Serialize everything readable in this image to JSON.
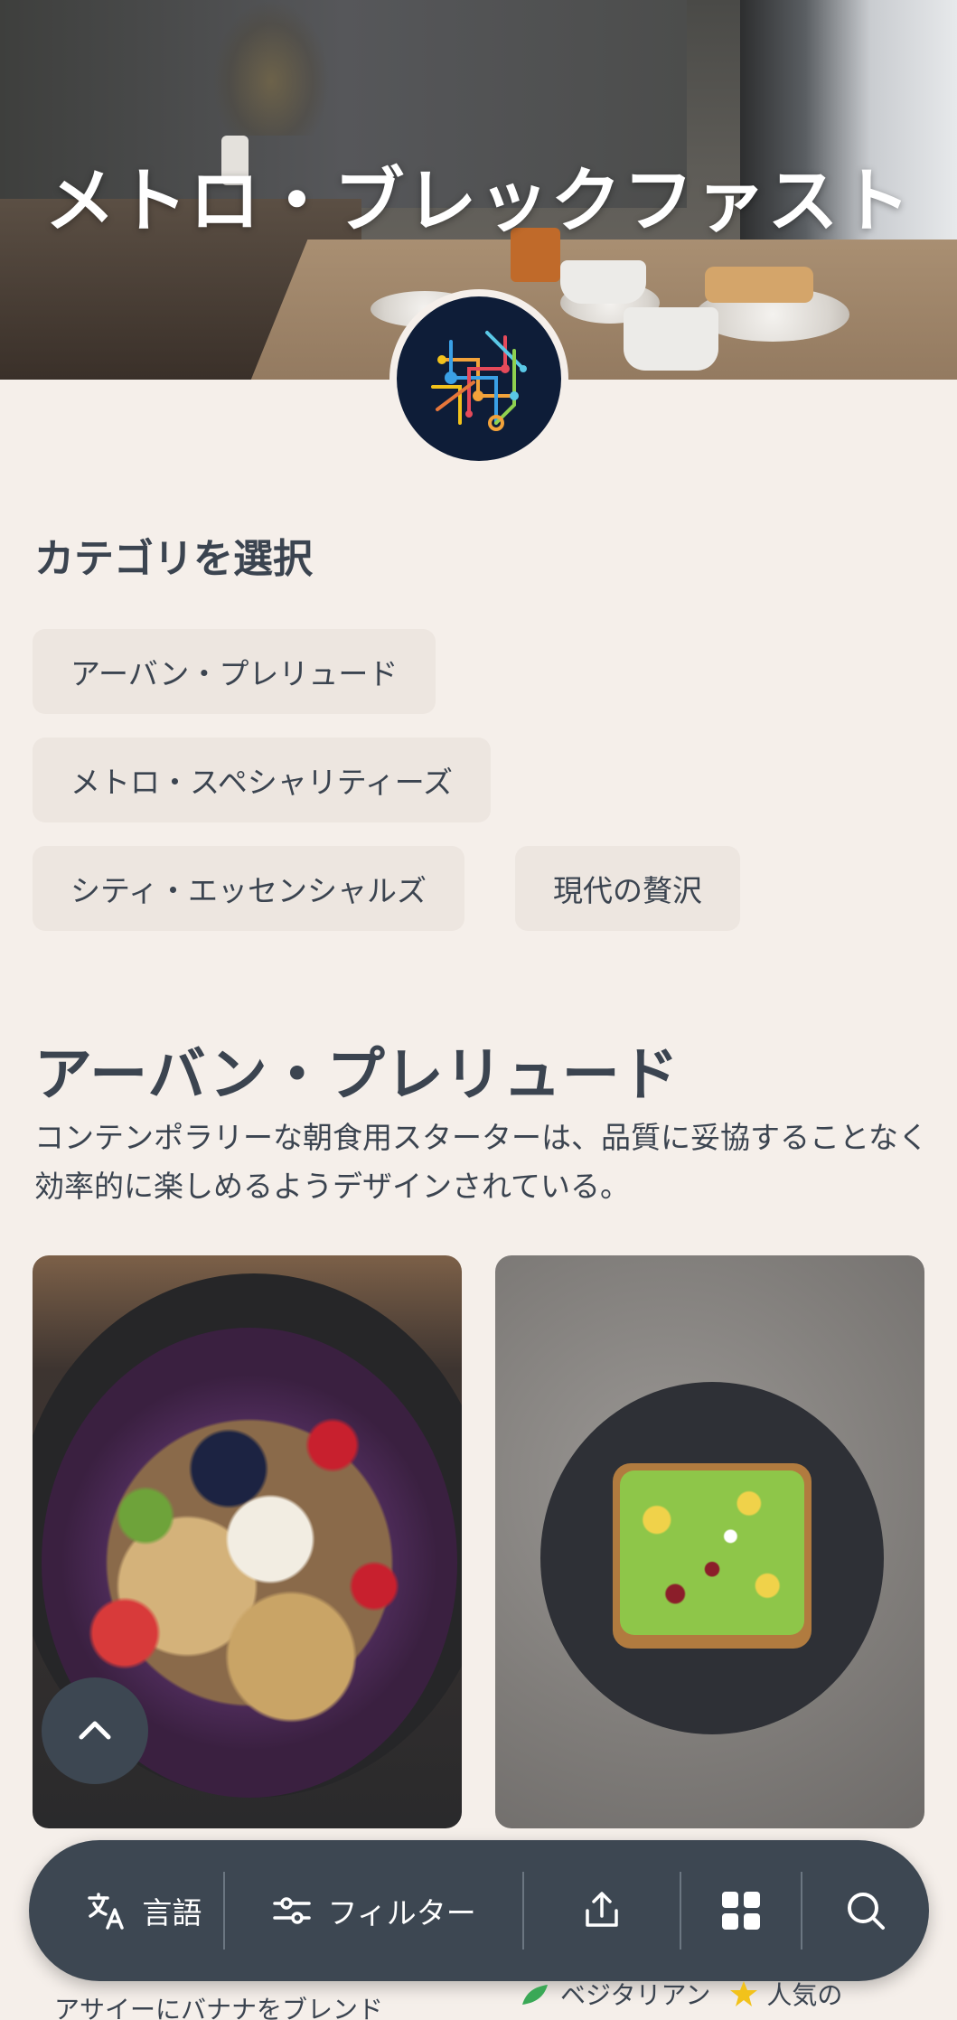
{
  "hero": {
    "title": "メトロ・ブレックファスト"
  },
  "category": {
    "heading": "カテゴリを選択",
    "chips": [
      {
        "label": "アーバン・プレリュード"
      },
      {
        "label": "メトロ・スペシャリティーズ"
      },
      {
        "label": "シティ・エッセンシャルズ"
      },
      {
        "label": "現代の贅沢"
      }
    ]
  },
  "section": {
    "title": "アーバン・プレリュード",
    "description": "コンテンポラリーな朝食用スターターは、品質に妥協することなく効率的に楽しめるようデザインされている。"
  },
  "bottom_bar": {
    "language_label": "言語",
    "filter_label": "フィルター"
  },
  "below": {
    "card1_desc_partial": "アサイーにバナナをブレンド",
    "tag_vegetarian": "ベジタリアン",
    "tag_popular": "人気の"
  },
  "colors": {
    "background": "#f5efea",
    "chip": "#ede6e0",
    "text": "#3b4450",
    "bar": "#3d4752",
    "star": "#f2c21b",
    "veg": "#3aa856"
  }
}
